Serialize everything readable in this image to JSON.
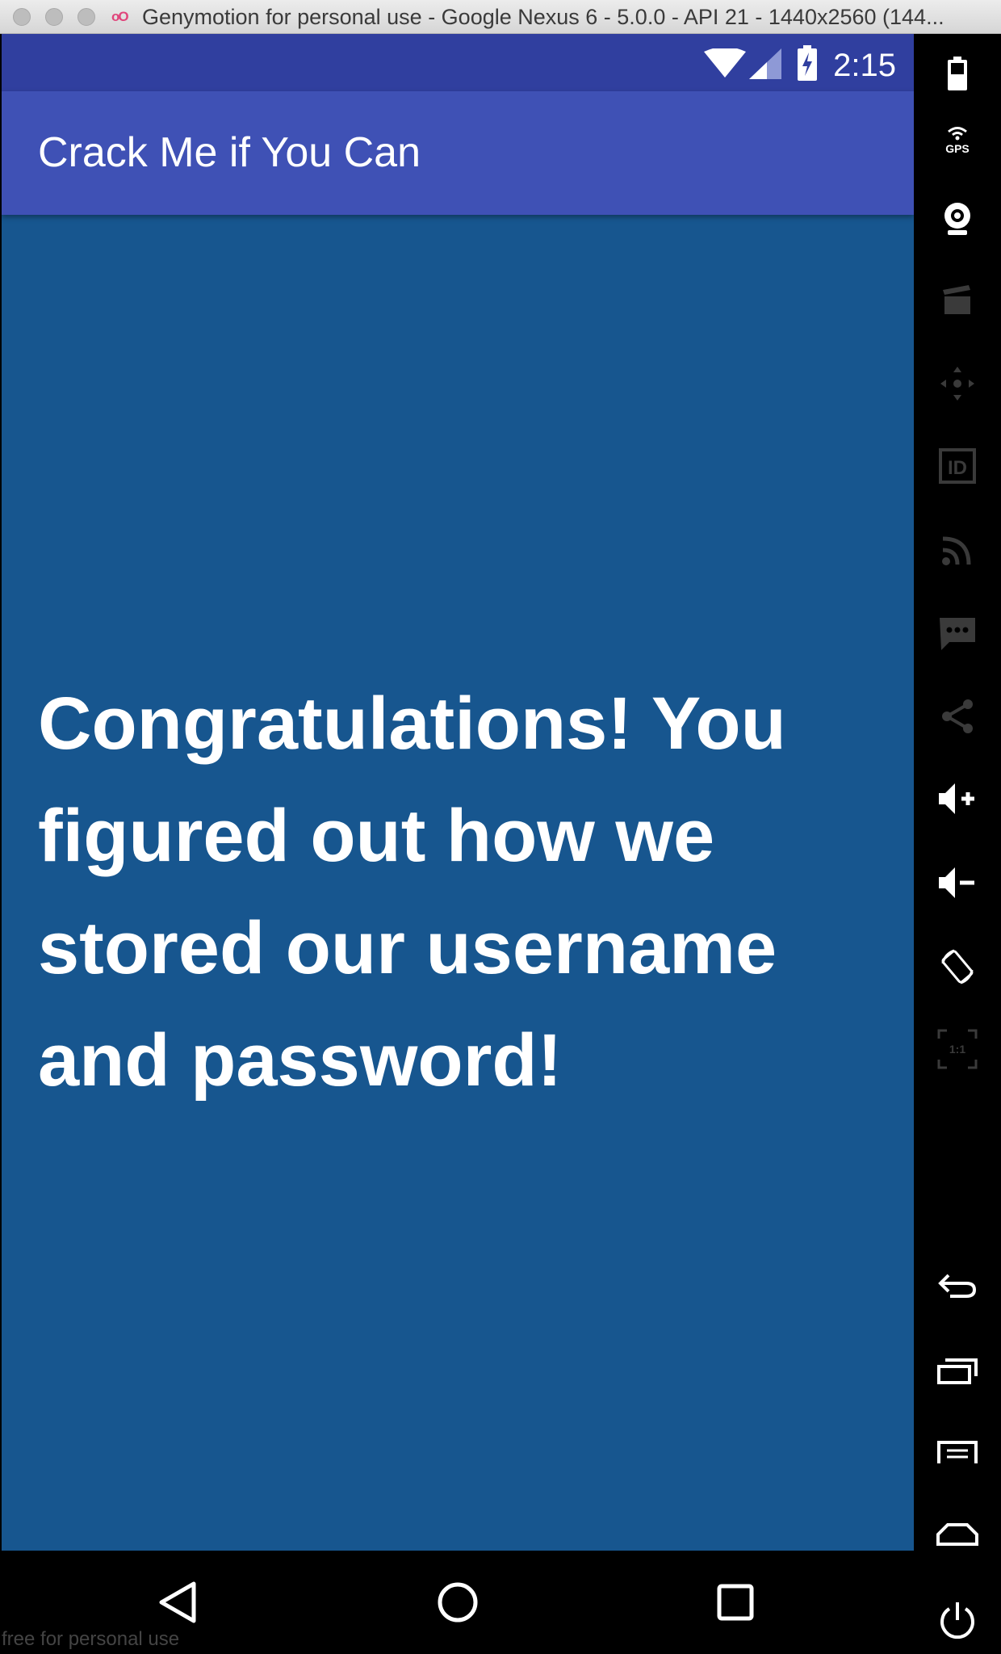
{
  "window": {
    "title": "Genymotion for personal use - Google Nexus 6 - 5.0.0 - API 21 - 1440x2560 (144..."
  },
  "status_bar": {
    "time": "2:15"
  },
  "app": {
    "title": "Crack Me if You Can",
    "message": "Congratulations! You figured out how we stored our username and password!"
  },
  "sidebar": {
    "gps_label": "GPS",
    "id_label": "ID",
    "pixel_ratio_label": "1:1"
  },
  "footer": {
    "note": "free for personal use"
  },
  "colors": {
    "status_bar": "#303f9f",
    "app_bar": "#3f51b5",
    "screen_background": "#17568f",
    "text": "#ffffff"
  },
  "icons": [
    "wifi-icon",
    "signal-icon",
    "battery-icon",
    "back-icon",
    "home-icon",
    "recent-apps-icon",
    "battery-tool-icon",
    "gps-icon",
    "webcam-icon",
    "capture-icon",
    "dpad-icon",
    "device-id-icon",
    "network-icon",
    "sms-icon",
    "share-icon",
    "volume-up-icon",
    "volume-down-icon",
    "rotate-icon",
    "pixel-perfect-icon",
    "sidebar-back-icon",
    "sidebar-recents-icon",
    "sidebar-menu-icon",
    "sidebar-home-icon",
    "power-icon"
  ]
}
